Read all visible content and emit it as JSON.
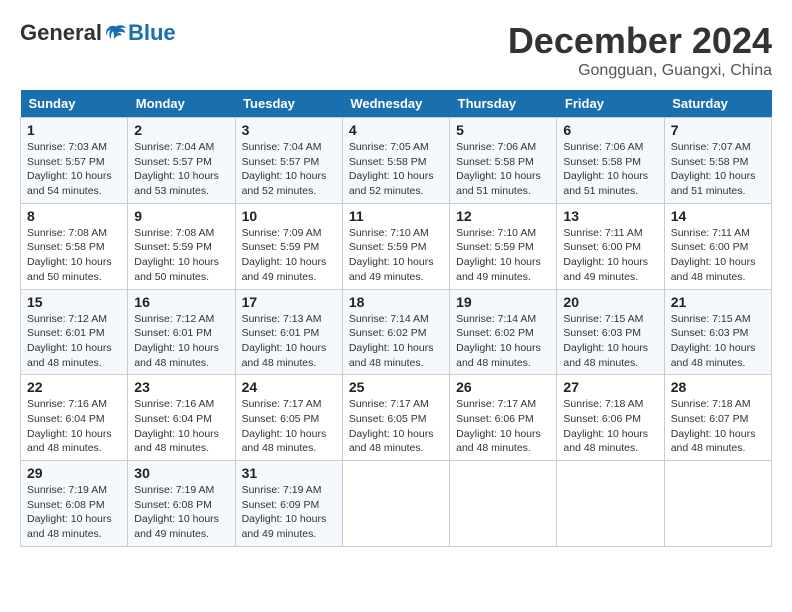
{
  "header": {
    "logo_general": "General",
    "logo_blue": "Blue",
    "month_title": "December 2024",
    "location": "Gongguan, Guangxi, China"
  },
  "calendar": {
    "days_of_week": [
      "Sunday",
      "Monday",
      "Tuesday",
      "Wednesday",
      "Thursday",
      "Friday",
      "Saturday"
    ],
    "weeks": [
      [
        null,
        null,
        null,
        null,
        null,
        null,
        null
      ]
    ],
    "cells": [
      {
        "day": 1,
        "col": 0,
        "sunrise": "7:03 AM",
        "sunset": "5:57 PM",
        "daylight": "10 hours and 54 minutes."
      },
      {
        "day": 2,
        "col": 1,
        "sunrise": "7:04 AM",
        "sunset": "5:57 PM",
        "daylight": "10 hours and 53 minutes."
      },
      {
        "day": 3,
        "col": 2,
        "sunrise": "7:04 AM",
        "sunset": "5:57 PM",
        "daylight": "10 hours and 52 minutes."
      },
      {
        "day": 4,
        "col": 3,
        "sunrise": "7:05 AM",
        "sunset": "5:58 PM",
        "daylight": "10 hours and 52 minutes."
      },
      {
        "day": 5,
        "col": 4,
        "sunrise": "7:06 AM",
        "sunset": "5:58 PM",
        "daylight": "10 hours and 51 minutes."
      },
      {
        "day": 6,
        "col": 5,
        "sunrise": "7:06 AM",
        "sunset": "5:58 PM",
        "daylight": "10 hours and 51 minutes."
      },
      {
        "day": 7,
        "col": 6,
        "sunrise": "7:07 AM",
        "sunset": "5:58 PM",
        "daylight": "10 hours and 51 minutes."
      },
      {
        "day": 8,
        "col": 0,
        "sunrise": "7:08 AM",
        "sunset": "5:58 PM",
        "daylight": "10 hours and 50 minutes."
      },
      {
        "day": 9,
        "col": 1,
        "sunrise": "7:08 AM",
        "sunset": "5:59 PM",
        "daylight": "10 hours and 50 minutes."
      },
      {
        "day": 10,
        "col": 2,
        "sunrise": "7:09 AM",
        "sunset": "5:59 PM",
        "daylight": "10 hours and 49 minutes."
      },
      {
        "day": 11,
        "col": 3,
        "sunrise": "7:10 AM",
        "sunset": "5:59 PM",
        "daylight": "10 hours and 49 minutes."
      },
      {
        "day": 12,
        "col": 4,
        "sunrise": "7:10 AM",
        "sunset": "5:59 PM",
        "daylight": "10 hours and 49 minutes."
      },
      {
        "day": 13,
        "col": 5,
        "sunrise": "7:11 AM",
        "sunset": "6:00 PM",
        "daylight": "10 hours and 49 minutes."
      },
      {
        "day": 14,
        "col": 6,
        "sunrise": "7:11 AM",
        "sunset": "6:00 PM",
        "daylight": "10 hours and 48 minutes."
      },
      {
        "day": 15,
        "col": 0,
        "sunrise": "7:12 AM",
        "sunset": "6:01 PM",
        "daylight": "10 hours and 48 minutes."
      },
      {
        "day": 16,
        "col": 1,
        "sunrise": "7:12 AM",
        "sunset": "6:01 PM",
        "daylight": "10 hours and 48 minutes."
      },
      {
        "day": 17,
        "col": 2,
        "sunrise": "7:13 AM",
        "sunset": "6:01 PM",
        "daylight": "10 hours and 48 minutes."
      },
      {
        "day": 18,
        "col": 3,
        "sunrise": "7:14 AM",
        "sunset": "6:02 PM",
        "daylight": "10 hours and 48 minutes."
      },
      {
        "day": 19,
        "col": 4,
        "sunrise": "7:14 AM",
        "sunset": "6:02 PM",
        "daylight": "10 hours and 48 minutes."
      },
      {
        "day": 20,
        "col": 5,
        "sunrise": "7:15 AM",
        "sunset": "6:03 PM",
        "daylight": "10 hours and 48 minutes."
      },
      {
        "day": 21,
        "col": 6,
        "sunrise": "7:15 AM",
        "sunset": "6:03 PM",
        "daylight": "10 hours and 48 minutes."
      },
      {
        "day": 22,
        "col": 0,
        "sunrise": "7:16 AM",
        "sunset": "6:04 PM",
        "daylight": "10 hours and 48 minutes."
      },
      {
        "day": 23,
        "col": 1,
        "sunrise": "7:16 AM",
        "sunset": "6:04 PM",
        "daylight": "10 hours and 48 minutes."
      },
      {
        "day": 24,
        "col": 2,
        "sunrise": "7:17 AM",
        "sunset": "6:05 PM",
        "daylight": "10 hours and 48 minutes."
      },
      {
        "day": 25,
        "col": 3,
        "sunrise": "7:17 AM",
        "sunset": "6:05 PM",
        "daylight": "10 hours and 48 minutes."
      },
      {
        "day": 26,
        "col": 4,
        "sunrise": "7:17 AM",
        "sunset": "6:06 PM",
        "daylight": "10 hours and 48 minutes."
      },
      {
        "day": 27,
        "col": 5,
        "sunrise": "7:18 AM",
        "sunset": "6:06 PM",
        "daylight": "10 hours and 48 minutes."
      },
      {
        "day": 28,
        "col": 6,
        "sunrise": "7:18 AM",
        "sunset": "6:07 PM",
        "daylight": "10 hours and 48 minutes."
      },
      {
        "day": 29,
        "col": 0,
        "sunrise": "7:19 AM",
        "sunset": "6:08 PM",
        "daylight": "10 hours and 48 minutes."
      },
      {
        "day": 30,
        "col": 1,
        "sunrise": "7:19 AM",
        "sunset": "6:08 PM",
        "daylight": "10 hours and 49 minutes."
      },
      {
        "day": 31,
        "col": 2,
        "sunrise": "7:19 AM",
        "sunset": "6:09 PM",
        "daylight": "10 hours and 49 minutes."
      }
    ]
  }
}
